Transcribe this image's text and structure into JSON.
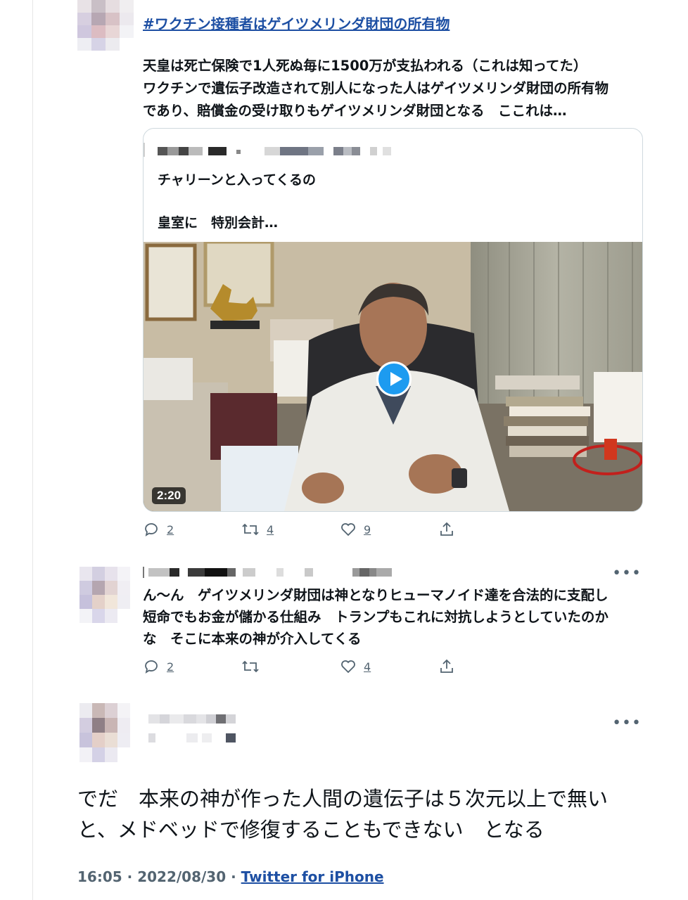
{
  "tweet1": {
    "hashtag": "#ワクチン接種者はゲイツメリンダ財団の所有物",
    "lines": [
      "天皇は死亡保険で1人死ぬ毎に1500万が支払われる（これは知ってた）",
      "ワクチンで遺伝子改造されて別人になった人はゲイツメリンダ財団の所有物",
      "であり、賠償金の受け取りもゲイツメリンダ財団となる　ここれは…"
    ],
    "quote": {
      "line1": "チャリーンと入ってくるの",
      "line2": "皇室に　特別会計…",
      "video_duration": "2:20"
    },
    "actions": {
      "replies": "2",
      "retweets": "4",
      "likes": "9"
    }
  },
  "reply1": {
    "lines": [
      "ん〜ん　ゲイツメリンダ財団は神となりヒューマノイド達を合法的に支配し",
      "短命でもお金が儲かる仕組み　トランプもこれに対抗しようとしていたのか",
      "な　そこに本来の神が介入してくる"
    ],
    "actions": {
      "replies": "2",
      "retweets": "",
      "likes": "4"
    }
  },
  "main": {
    "lines": [
      "でだ　本来の神が作った人間の遺伝子は５次元以上で無い",
      "と、メドベッドで修復することもできない　となる"
    ],
    "time": "16:05",
    "date": "2022/08/30",
    "source": "Twitter for iPhone"
  },
  "more_label": "•••",
  "separator": " · ",
  "colors": {
    "link": "#1d4fa3",
    "accent": "#1d9bf0",
    "muted": "#536471"
  }
}
